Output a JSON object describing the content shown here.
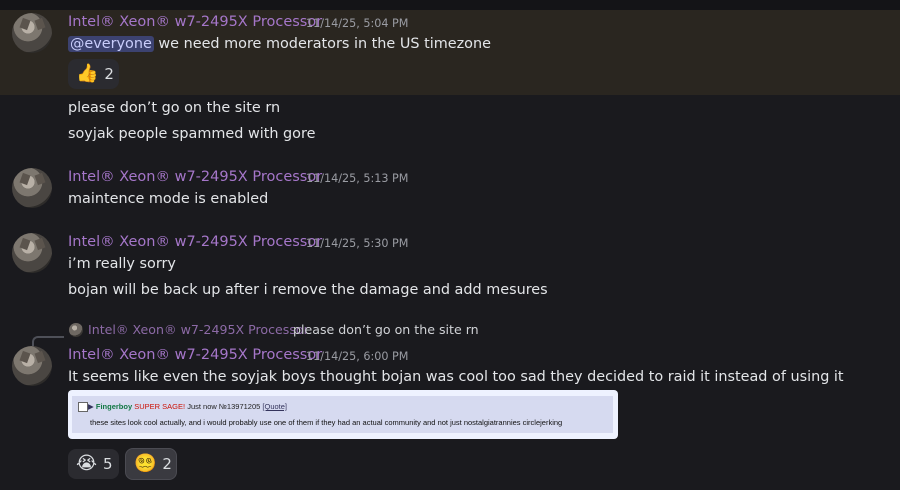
{
  "author": "Intel® Xeon® w7-2495X Processor",
  "messages": [
    {
      "timestamp": "11/14/25, 5:04 PM",
      "mention": "@everyone",
      "text": " we need more moderators in the US timezone",
      "reaction": {
        "emoji": "👍",
        "count": "2"
      }
    },
    {
      "lines": [
        "please don’t go on the site rn",
        "soyjak people spammed with gore"
      ]
    },
    {
      "timestamp": "11/14/25, 5:13 PM",
      "text": "maintence mode is enabled"
    },
    {
      "timestamp": "11/14/25, 5:30 PM",
      "lines": [
        "i’m really sorry",
        "bojan will be back up after i remove the damage and add mesures"
      ]
    },
    {
      "timestamp": "11/14/25, 6:00 PM",
      "reply": {
        "author": "Intel® Xeon® w7-2495X Processor",
        "text": "please don’t go on the site rn"
      },
      "text": "It seems like even the soyjak boys thought bojan was cool too sad they decided to raid it instead of using it",
      "embed": {
        "arrow": "▶",
        "poster": "Fingerboy",
        "sage": "SUPER SAGE!",
        "time": "Just now",
        "post_no": "№13971205",
        "quote": "[Quote]",
        "body": "these sites look cool actually, and i would probably use one of them if they had an actual community and not just nostalgiatrannies circlejerking"
      },
      "reactions": [
        {
          "emoji": "😭",
          "count": "5"
        },
        {
          "emoji": "😵‍💫",
          "count": "2"
        }
      ]
    }
  ]
}
